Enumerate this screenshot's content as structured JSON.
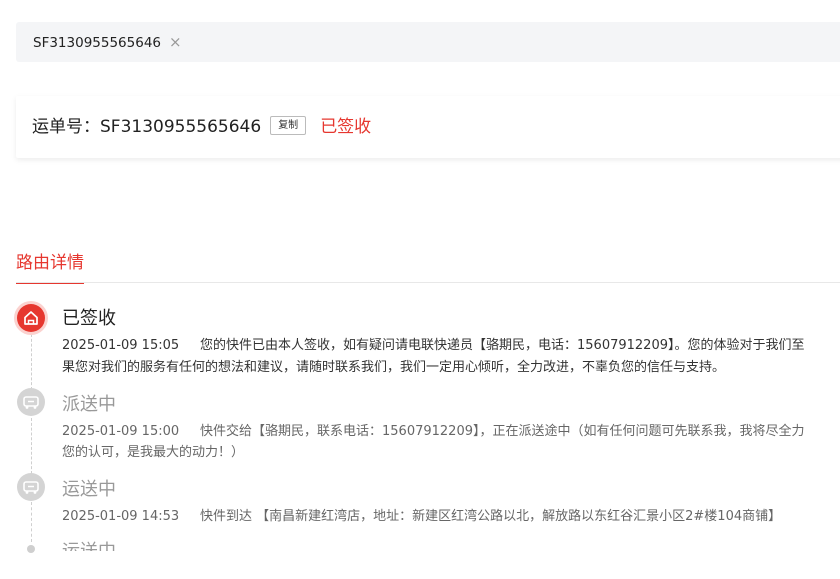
{
  "search": {
    "tag_text": "SF3130955565646",
    "close_glyph": "×"
  },
  "waybill": {
    "label": "运单号：SF3130955565646",
    "copy_label": "复制",
    "status": "已签收",
    "status_color": "#e6372f"
  },
  "route": {
    "tab_title": "路由详情",
    "events": [
      {
        "status": "已签收",
        "icon": "home-icon",
        "time": "2025-01-09 15:05",
        "desc_line1": "您的快件已由本人签收，如有疑问请电联快递员【骆期民，电话：15607912209】。您的体验对于我们至",
        "desc_line2": "果您对我们的服务有任何的想法和建议，请随时联系我们，我们一定用心倾听，全力改进，不辜负您的信任与支持。"
      },
      {
        "status": "派送中",
        "icon": "truck-icon",
        "time": "2025-01-09 15:00",
        "desc_line1": "快件交给【骆期民，联系电话：15607912209】，正在派送途中（如有任何问题可先联系我，我将尽全力",
        "desc_line2": "您的认可，是我最大的动力！）"
      },
      {
        "status": "运送中",
        "icon": "truck-icon",
        "time": "2025-01-09 14:53",
        "desc_line1": "快件到达 【南昌新建红湾店，地址：新建区红湾公路以北，解放路以东红谷汇景小区2#楼104商铺】"
      },
      {
        "status": "运送中",
        "icon": "dot-icon"
      }
    ]
  }
}
